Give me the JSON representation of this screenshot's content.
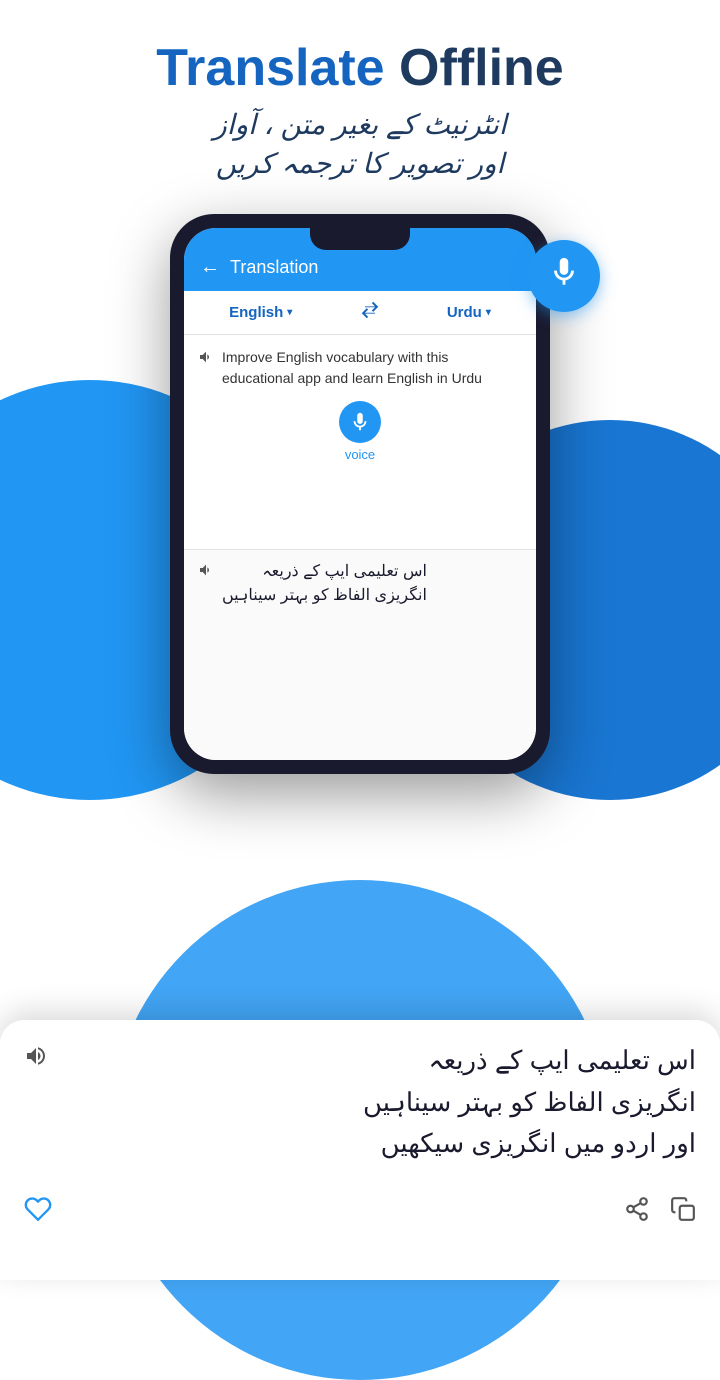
{
  "header": {
    "title_translate": "Translate",
    "title_offline": " Offline",
    "subtitle_line1": "انٹرنیٹ کے بغیر متن ، آواز",
    "subtitle_line2": "اور تصویر کا ترجمہ کریں"
  },
  "app_bar": {
    "title": "Translation",
    "back_label": "←"
  },
  "lang_selector": {
    "source_lang": "English",
    "target_lang": "Urdu",
    "swap_symbol": "⇌"
  },
  "input_section": {
    "text": "Improve English vocabulary with this educational app and learn English in Urdu",
    "voice_label": "voice"
  },
  "output_section": {
    "text": "اس تعلیمی ایپ کے ذریعہ انگریزی الفاظ کو بہتر سیناہیں"
  },
  "bottom_card": {
    "urdu_text_line1": "اس تعلیمی ایپ کے ذریعہ",
    "urdu_text_line2": "انگریزی الفاظ کو بہتر سیناہیں",
    "urdu_text_line3": "اور اردو میں انگریزی سیکھیں"
  },
  "icons": {
    "mic": "🎤",
    "speaker": "🔊",
    "heart": "♡",
    "share": "share",
    "copy": "copy",
    "back_arrow": "←",
    "dropdown": "▾"
  },
  "colors": {
    "primary": "#2196F3",
    "dark_blue": "#1565C0",
    "navy": "#1E3A5F",
    "white": "#ffffff"
  }
}
